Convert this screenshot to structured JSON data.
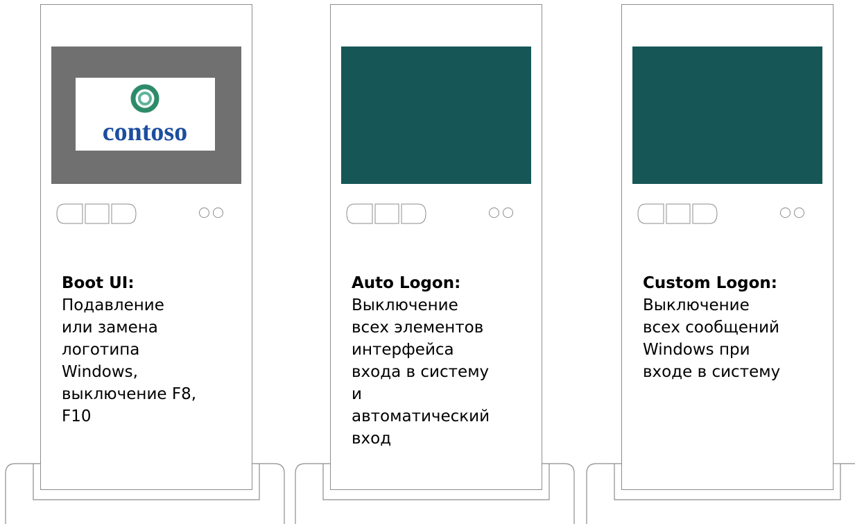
{
  "panels": [
    {
      "title": "Boot UI:",
      "body": "Подавление\nили замена\nлоготипа\nWindows,\nвыключение F8,\nF10",
      "screen_color": "#707070",
      "logo_text": "contoso"
    },
    {
      "title": "Auto Logon:",
      "body": "Выключение\nвсех элементов\nинтерфейса\nвхода в систему\nи\nавтоматический\nвход",
      "screen_color": "#175656"
    },
    {
      "title": "Custom Logon:",
      "body": "Выключение\nвсех сообщений\nWindows при\nвходе в систему",
      "screen_color": "#175656"
    }
  ],
  "colors": {
    "outline": "#8c8c8c",
    "logo_blue": "#1c4e9e",
    "logo_green": "#2e8b6a"
  }
}
